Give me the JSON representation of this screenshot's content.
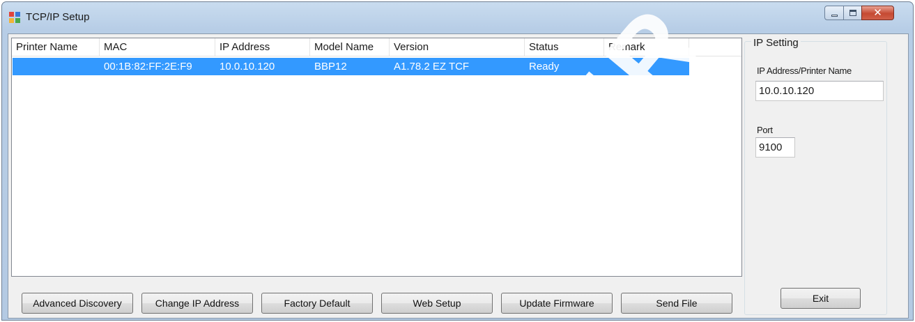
{
  "window": {
    "title": "TCP/IP Setup",
    "controls": {
      "minimize": "minimize-icon",
      "maximize": "maximize-icon",
      "close": "close-icon"
    }
  },
  "list": {
    "columns": [
      "Printer Name",
      "MAC",
      "IP Address",
      "Model Name",
      "Version",
      "Status",
      "Remark"
    ],
    "rows": [
      {
        "printer_name": "",
        "mac": "00:1B:82:FF:2E:F9",
        "ip_address": "10.0.10.120",
        "model_name": "BBP12",
        "version": "A1.78.2 EZ TCF",
        "status": "Ready",
        "remark": "",
        "selected": true
      }
    ]
  },
  "ip_setting": {
    "group_title": "IP Setting",
    "address_label": "IP Address/Printer Name",
    "address_value": "10.0.10.120",
    "port_label": "Port",
    "port_value": "9100",
    "exit_label": "Exit"
  },
  "buttons": {
    "advanced_discovery": "Advanced Discovery",
    "change_ip": "Change IP Address",
    "factory_default": "Factory Default",
    "web_setup": "Web Setup",
    "update_firmware": "Update Firmware",
    "send_file": "Send File"
  },
  "colors": {
    "selection": "#3399ff",
    "title_gradient": "#b7cde6",
    "close_button": "#c54a32"
  }
}
